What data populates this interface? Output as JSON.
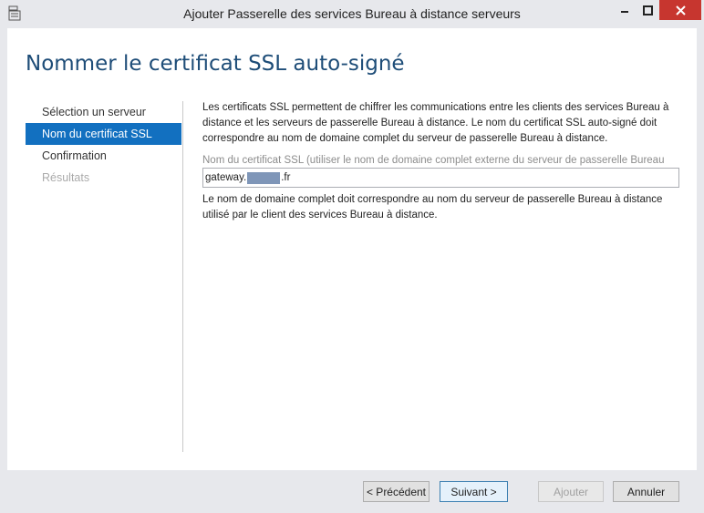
{
  "window": {
    "title": "Ajouter Passerelle des services Bureau à distance serveurs",
    "minimize_glyph": "▬",
    "maximize_glyph": "☐",
    "close_glyph": "✕",
    "accent_close": "#c7362f"
  },
  "page": {
    "title": "Nommer le certificat SSL auto-signé"
  },
  "nav": {
    "items": [
      {
        "label": "Sélection un serveur",
        "state": "normal"
      },
      {
        "label": "Nom du certificat SSL",
        "state": "active"
      },
      {
        "label": "Confirmation",
        "state": "normal"
      },
      {
        "label": "Résultats",
        "state": "disabled"
      }
    ],
    "active_color": "#1270c0"
  },
  "content": {
    "intro": "Les certificats SSL permettent de chiffrer les communications entre les clients des services Bureau à distance et les serveurs de passerelle Bureau à distance. Le nom du certificat SSL auto-signé doit correspondre au nom de domaine complet du serveur de passerelle Bureau à distance.",
    "field_label": "Nom du certificat SSL (utiliser le nom de domaine complet externe du serveur de passerelle Bureau",
    "field_value_prefix": "gateway.",
    "field_value_suffix": ".fr",
    "note": "Le nom de domaine complet doit correspondre au nom du serveur de passerelle Bureau à distance utilisé par le client des services Bureau à distance."
  },
  "footer": {
    "prev": "< Précédent",
    "next": "Suivant >",
    "add": "Ajouter",
    "cancel": "Annuler"
  }
}
